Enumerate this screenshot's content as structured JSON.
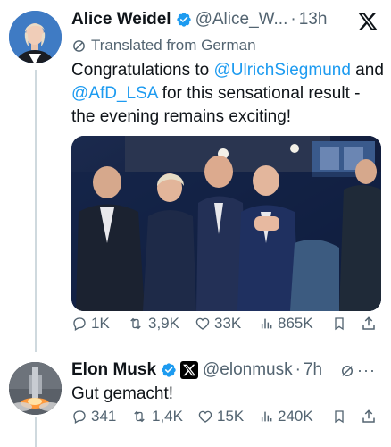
{
  "tweet": {
    "author_name": "Alice Weidel",
    "handle": "@Alice_W...",
    "time": "13h",
    "translated_label": "Translated from German",
    "text_part1": "Congratulations to ",
    "mention1": "@UlrichSiegmund",
    "text_part2": " and ",
    "mention2": "@AfD_LSA",
    "text_part3": " for this sensational result - the evening remains exciting!",
    "stats": {
      "replies": "1K",
      "reposts": "3,9K",
      "likes": "33K",
      "views": "865K"
    }
  },
  "reply": {
    "author_name": "Elon Musk",
    "handle": "@elonmusk",
    "time": "7h",
    "text": "Gut gemacht!",
    "stats": {
      "replies": "341",
      "reposts": "1,4K",
      "likes": "15K",
      "views": "240K"
    }
  },
  "icons": {
    "verified": "verified-badge-icon",
    "x_logo": "x-logo-icon",
    "translate": "translate-icon",
    "reply": "reply-icon",
    "repost": "repost-icon",
    "like": "heart-icon",
    "views": "views-icon",
    "bookmark": "bookmark-icon",
    "share": "share-icon"
  },
  "colors": {
    "accent": "#1d9bf0",
    "text": "#0f1419",
    "muted": "#536471"
  }
}
